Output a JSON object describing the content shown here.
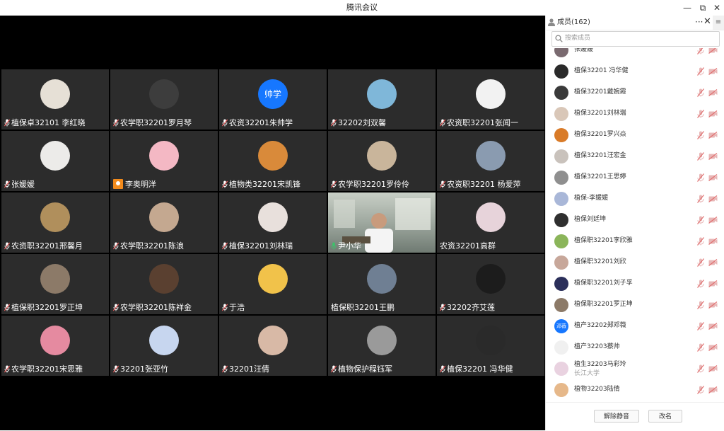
{
  "window": {
    "title": "腾讯会议",
    "minimize": "—",
    "restore": "⧉",
    "close": "✕"
  },
  "colors": {
    "accent": "#1a73e8",
    "muted_red": "#e25b5b",
    "active_border": "#3cc26a",
    "share_orange": "#f38b1c"
  },
  "grid": {
    "tiles": [
      {
        "name": "植保卓32101 李红晓",
        "avatar_color": "#e6e0d6",
        "avatar_text": "",
        "mic": "muted"
      },
      {
        "name": "农学职32201罗月琴",
        "avatar_color": "#3d3d3d",
        "avatar_text": "",
        "mic": "muted"
      },
      {
        "name": "农资32201朱帅学",
        "avatar_color": "#1677ff",
        "avatar_text": "帅学",
        "mic": "muted"
      },
      {
        "name": "32202刘双馨",
        "avatar_color": "#7fb7d9",
        "avatar_text": "",
        "mic": "muted"
      },
      {
        "name": "农资职32201张闻一",
        "avatar_color": "#f2f2f2",
        "avatar_text": "",
        "mic": "muted"
      },
      {
        "name": "张媛媛",
        "avatar_color": "#ecebe9",
        "avatar_text": "",
        "mic": "muted"
      },
      {
        "name": "李奥明洋",
        "avatar_color": "#f4b8c4",
        "avatar_text": "",
        "mic": "share"
      },
      {
        "name": "植物类32201宋凯锋",
        "avatar_color": "#d98a3a",
        "avatar_text": "",
        "mic": "muted"
      },
      {
        "name": "农学职32201罗伶伶",
        "avatar_color": "#c9b59b",
        "avatar_text": "",
        "mic": "muted"
      },
      {
        "name": "农资职32201 杨爱萍",
        "avatar_color": "#8a9bb0",
        "avatar_text": "",
        "mic": "muted"
      },
      {
        "name": "农资职32201邢馨月",
        "avatar_color": "#b08f5c",
        "avatar_text": "",
        "mic": "muted"
      },
      {
        "name": "农学职32201陈浪",
        "avatar_color": "#c4a890",
        "avatar_text": "",
        "mic": "muted"
      },
      {
        "name": "植保32201刘林瑞",
        "avatar_color": "#e8e0dc",
        "avatar_text": "",
        "mic": "muted"
      },
      {
        "name": "尹小华",
        "avatar_color": "",
        "avatar_text": "",
        "mic": "active",
        "video": true
      },
      {
        "name": "农资32201高群",
        "avatar_color": "#e7d3da",
        "avatar_text": "",
        "mic": "none"
      },
      {
        "name": "植保职32201罗正坤",
        "avatar_color": "#8c7a68",
        "avatar_text": "",
        "mic": "muted"
      },
      {
        "name": "农学职32201陈祥金",
        "avatar_color": "#5a4030",
        "avatar_text": "",
        "mic": "muted"
      },
      {
        "name": "于浩",
        "avatar_color": "#f1c24a",
        "avatar_text": "",
        "mic": "muted"
      },
      {
        "name": "植保职32201王鹏",
        "avatar_color": "#6f7f93",
        "avatar_text": "",
        "mic": "none"
      },
      {
        "name": "32202齐艾莲",
        "avatar_color": "#1c1c1c",
        "avatar_text": "",
        "mic": "muted"
      },
      {
        "name": "农学职32201宋思雅",
        "avatar_color": "#e58aa0",
        "avatar_text": "",
        "mic": "muted"
      },
      {
        "name": "32201张亚竹",
        "avatar_color": "#c7d6ef",
        "avatar_text": "",
        "mic": "muted"
      },
      {
        "name": "32201汪倩",
        "avatar_color": "#d8b9a6",
        "avatar_text": "",
        "mic": "muted"
      },
      {
        "name": "植物保护程钰军",
        "avatar_color": "#9a9a9a",
        "avatar_text": "",
        "mic": "muted"
      },
      {
        "name": "植保32201 冯华健",
        "avatar_color": "#2a2a2a",
        "avatar_text": "",
        "mic": "muted"
      }
    ]
  },
  "sidebar": {
    "title": "成员(162)",
    "more": "···",
    "close": "✕",
    "menu": "≡",
    "search_placeholder": "搜索成员",
    "members": [
      {
        "name": "张媛媛",
        "sub": "",
        "avatar_color": "#7a6a70",
        "avatar_text": ""
      },
      {
        "name": "植保32201 冯华健",
        "sub": "",
        "avatar_color": "#2a2a2a",
        "avatar_text": ""
      },
      {
        "name": "植保32201戴婉霞",
        "sub": "",
        "avatar_color": "#3a3a3a",
        "avatar_text": ""
      },
      {
        "name": "植保32201刘林瑞",
        "sub": "",
        "avatar_color": "#d9c7b8",
        "avatar_text": ""
      },
      {
        "name": "植保32201罗兴焱",
        "sub": "",
        "avatar_color": "#d97b28",
        "avatar_text": ""
      },
      {
        "name": "植保32201汪宏金",
        "sub": "",
        "avatar_color": "#c9c2bc",
        "avatar_text": ""
      },
      {
        "name": "植保32201王思婷",
        "sub": "",
        "avatar_color": "#8f8f8f",
        "avatar_text": ""
      },
      {
        "name": "植保-李媛媛",
        "sub": "",
        "avatar_color": "#a9b7d8",
        "avatar_text": ""
      },
      {
        "name": "植保刘廷坤",
        "sub": "",
        "avatar_color": "#2f2f2f",
        "avatar_text": ""
      },
      {
        "name": "植保职32201李欣雅",
        "sub": "",
        "avatar_color": "#8bb55a",
        "avatar_text": ""
      },
      {
        "name": "植保职32201刘欣",
        "sub": "",
        "avatar_color": "#c7a79a",
        "avatar_text": ""
      },
      {
        "name": "植保职32201刘子孚",
        "sub": "",
        "avatar_color": "#2b2f5a",
        "avatar_text": ""
      },
      {
        "name": "植保职32201罗正坤",
        "sub": "",
        "avatar_color": "#8c7a68",
        "avatar_text": ""
      },
      {
        "name": "植产32202郑邓薇",
        "sub": "",
        "avatar_color": "#1677ff",
        "avatar_text": "邓薇"
      },
      {
        "name": "植产32203蔡帅",
        "sub": "",
        "avatar_color": "#f0f0f0",
        "avatar_text": ""
      },
      {
        "name": "植生32203马彩玲",
        "sub": "长江大学",
        "avatar_color": "#e9d2e0",
        "avatar_text": ""
      },
      {
        "name": "植物32203陆倩",
        "sub": "",
        "avatar_color": "#e6b88a",
        "avatar_text": ""
      }
    ],
    "footer": {
      "unmute_label": "解除静音",
      "rename_label": "改名"
    }
  }
}
